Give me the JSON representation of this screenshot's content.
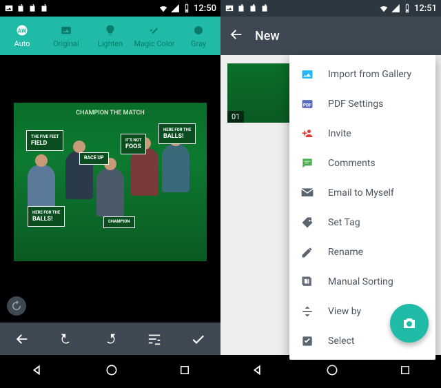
{
  "left": {
    "status": {
      "time": "12:50"
    },
    "filters": {
      "auto": "Auto",
      "original": "Original",
      "lighten": "Lighten",
      "magic": "Magic Color",
      "gray": "Gray"
    },
    "photo": {
      "banner": "CHAMPION THE MATCH",
      "sign1_top": "THE FIVE FEET",
      "sign1_bottom": "FIELD",
      "sign2": "RACE UP",
      "sign3_top": "IT'S NOT",
      "sign3_bottom": "FOOS",
      "sign4_top": "HERE FOR THE",
      "sign4_bottom": "BALLS!",
      "sign5_top": "HERE FOR THE",
      "sign5_bottom": "BALLS!",
      "sign6": "CHAMPION"
    }
  },
  "right": {
    "status": {
      "time": "12:51"
    },
    "appbar": {
      "title": "New"
    },
    "thumb": {
      "badge": "01"
    },
    "menu": {
      "import": "Import from Gallery",
      "pdf": "PDF Settings",
      "invite": "Invite",
      "comments": "Comments",
      "email": "Email to Myself",
      "tag": "Set Tag",
      "rename": "Rename",
      "sort": "Manual Sorting",
      "viewby": "View by",
      "select": "Select"
    }
  }
}
